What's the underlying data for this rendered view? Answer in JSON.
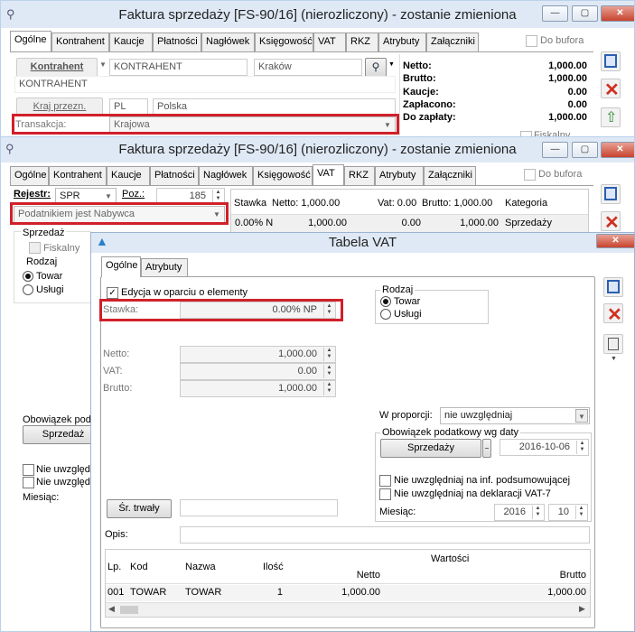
{
  "win1": {
    "title": "Faktura sprzedaży [FS-90/16] (nierozliczony) - zostanie zmieniona",
    "tabs": [
      "Ogólne",
      "Kontrahent",
      "Kaucje",
      "Płatności",
      "Nagłówek",
      "Księgowość",
      "VAT",
      "RKZ",
      "Atrybuty",
      "Załączniki"
    ],
    "do_bufora": "Do bufora",
    "kontrahent_btn": "Kontrahent",
    "kontrahent_code": "KONTRAHENT",
    "kontrahent_city": "Kraków",
    "kontrahent_name": "KONTRAHENT",
    "kraj_label": "Kraj przezn.",
    "kraj_code": "PL",
    "kraj_name": "Polska",
    "transakcja_label": "Transakcja:",
    "transakcja_value": "Krajowa",
    "summary": [
      {
        "label": "Netto:",
        "value": "1,000.00"
      },
      {
        "label": "Brutto:",
        "value": "1,000.00"
      },
      {
        "label": "Kaucje:",
        "value": "0.00"
      },
      {
        "label": "Zapłacono:",
        "value": "0.00"
      },
      {
        "label": "Do zapłaty:",
        "value": "1,000.00"
      }
    ],
    "fiskalny_partial": "Fiskalny"
  },
  "win2": {
    "title": "Faktura sprzedaży [FS-90/16] (nierozliczony) - zostanie zmieniona",
    "tabs": [
      "Ogólne",
      "Kontrahent",
      "Kaucje",
      "Płatności",
      "Nagłówek",
      "Księgowość",
      "VAT",
      "RKZ",
      "Atrybuty",
      "Załączniki"
    ],
    "do_bufora": "Do bufora",
    "rejestr_label": "Rejestr:",
    "rejestr_value": "SPR",
    "poz_label": "Poz.:",
    "poz_value": "185",
    "podatnik": "Podatnikiem jest Nabywca",
    "grid_headers": {
      "stawka": "Stawka",
      "netto": "Netto: 1,000.00",
      "vat": "Vat: 0.00",
      "brutto": "Brutto: 1,000.00",
      "kategoria": "Kategoria"
    },
    "grid_row": {
      "stawka": "0.00% N",
      "netto": "1,000.00",
      "vat": "0.00",
      "brutto": "1,000.00",
      "kategoria": "Sprzedaży"
    },
    "sprzedaz_label": "Sprzedaż",
    "fiskalny": "Fiskalny",
    "rodzaj_label": "Rodzaj",
    "towar": "Towar",
    "uslugi": "Usługi",
    "obowiazek_partial": "Obowiązek poda",
    "sprzedaz_btn": "Sprzedaż",
    "nie_uwzgl_1": "Nie uwzględn",
    "nie_uwzgl_2": "Nie uwzględn",
    "miesiac": "Miesiąc:"
  },
  "vat": {
    "title": "Tabela VAT",
    "tabs": [
      "Ogólne",
      "Atrybuty"
    ],
    "edycja": "Edycja w oparciu o elementy",
    "stawka_label": "Stawka:",
    "stawka_value": "0.00% NP",
    "rodzaj_label": "Rodzaj",
    "towar": "Towar",
    "uslugi": "Usługi",
    "netto_label": "Netto:",
    "netto_value": "1,000.00",
    "vat_label": "VAT:",
    "vat_value": "0.00",
    "brutto_label": "Brutto:",
    "brutto_value": "1,000.00",
    "proporcji_label": "W proporcji:",
    "proporcji_value": "nie uwzględniaj",
    "obowiazek_label": "Obowiązek podatkowy wg daty",
    "obowiazek_btn": "Sprzedaży",
    "obowiazek_date": "2016-10-06",
    "chk_podsum": "Nie uwzględniaj na inf. podsumowującej",
    "chk_vat7": "Nie uwzględniaj na deklaracji VAT-7",
    "miesiac_label": "Miesiąc:",
    "miesiac_year": "2016",
    "miesiac_month": "10",
    "sr_trwaly": "Śr. trwały",
    "opis_label": "Opis:",
    "table": {
      "lp": "Lp.",
      "kod": "Kod",
      "nazwa": "Nazwa",
      "ilosc": "Ilość",
      "wartosci": "Wartości",
      "netto": "Netto",
      "brutto": "Brutto",
      "rows": [
        {
          "lp": "001",
          "kod": "TOWAR",
          "nazwa": "TOWAR",
          "ilosc": "1",
          "netto": "1,000.00",
          "brutto": "1,000.00"
        }
      ]
    }
  },
  "colors": {
    "highlight": "#d0202a",
    "titlebar": "#dfe9f5",
    "close": "#c8442f"
  }
}
